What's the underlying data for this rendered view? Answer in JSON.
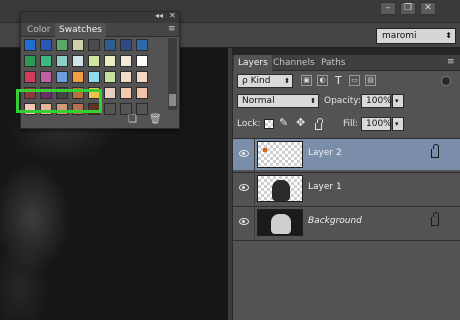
{
  "workspace": {
    "selected": "maromi"
  },
  "window_controls": {
    "minimize": "–",
    "restore": "❐",
    "close": "✕"
  },
  "swatches_panel": {
    "collapse_label": "◂◂",
    "close_label": "✕",
    "menu_label": "≡",
    "tabs": [
      {
        "label": "Color",
        "active": false
      },
      {
        "label": "Swatches",
        "active": true
      }
    ],
    "swatch_colors": [
      [
        "#1e6fd2",
        "#2a56b8",
        "#5aa86a",
        "#cfcfa8",
        "#4b4b4b",
        "#2d5e90",
        "#304a85",
        "#2f6aa8"
      ],
      [
        "#2a9a55",
        "#3db880",
        "#8ed0c8",
        "#cfe5e8",
        "#cfe6a0",
        "#ecedc3",
        "#f2e8dc",
        "#ffffff"
      ],
      [
        "#d23c5c",
        "#c060a0",
        "#6a9ee0",
        "#f0a040",
        "#8edaf0",
        "#c7e0a0",
        "#f3dcc8",
        "#f7d6c4"
      ],
      [
        "#8f3a3a",
        "#6a2d6a",
        "#434343",
        "#b87040",
        "#f0c050",
        "#e8d0c0",
        "#f5c8b0",
        "#f1c2a8"
      ],
      [
        "#f4c8b4",
        "#e8b296",
        "#d49a78",
        "#b96f52",
        "#5a3426",
        "#555555",
        "#555555",
        "#555555"
      ]
    ],
    "new_swatch_icon": "new-swatch-icon",
    "trash_icon": "trash-icon"
  },
  "layers_panel": {
    "tabs": [
      {
        "label": "Layers",
        "active": true
      },
      {
        "label": "Channels",
        "active": false
      },
      {
        "label": "Paths",
        "active": false
      }
    ],
    "panel_menu": "≡",
    "filter": {
      "prefix": "ρ",
      "label": "Kind"
    },
    "blend_mode": "Normal",
    "opacity_label": "Opacity:",
    "opacity_value": "100%",
    "lock_label": "Lock:",
    "fill_label": "Fill:",
    "fill_value": "100%",
    "layers": [
      {
        "name": "Layer 2",
        "selected": true,
        "locked": true,
        "italic": false
      },
      {
        "name": "Layer 1",
        "selected": false,
        "locked": false,
        "italic": false
      },
      {
        "name": "Background",
        "selected": false,
        "locked": true,
        "italic": true
      }
    ]
  }
}
